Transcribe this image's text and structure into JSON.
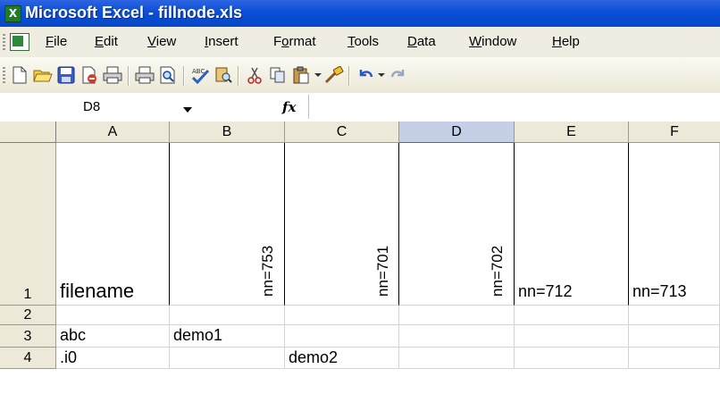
{
  "window": {
    "title": "Microsoft Excel - fillnode.xls"
  },
  "menu": [
    "File",
    "Edit",
    "View",
    "Insert",
    "Format",
    "Tools",
    "Data",
    "Window",
    "Help"
  ],
  "toolbar": {
    "buttons": [
      "new-icon",
      "open-icon",
      "save-icon",
      "permission-icon",
      "print-icon",
      "print-preview-icon",
      "spelling-icon",
      "research-icon",
      "cut-icon",
      "copy-icon",
      "paste-icon",
      "format-painter-icon",
      "undo-icon",
      "redo-icon"
    ]
  },
  "formula_bar": {
    "name_box": "D8",
    "fx": "fx",
    "formula": ""
  },
  "sheet": {
    "columns": [
      "A",
      "B",
      "C",
      "D",
      "E",
      "F"
    ],
    "active_column": "D",
    "rows": [
      {
        "num": "1",
        "cells": {
          "A": "filename",
          "B": "nn=753",
          "C": "nn=701",
          "D": "nn=702",
          "E": "nn=712",
          "F": "nn=713"
        }
      },
      {
        "num": "2",
        "cells": {
          "A": "",
          "B": "",
          "C": "",
          "D": "",
          "E": "",
          "F": ""
        }
      },
      {
        "num": "3",
        "cells": {
          "A": "abc",
          "B": "demo1",
          "C": "",
          "D": "",
          "E": "",
          "F": ""
        }
      },
      {
        "num": "4",
        "cells": {
          "A": ".i0",
          "B": "",
          "C": "demo2",
          "D": "",
          "E": "",
          "F": ""
        }
      }
    ]
  },
  "colors": {
    "title_bar": "#0a4fd8",
    "menu_bg": "#efede2",
    "header_bg": "#ece9d8",
    "active_header": "#c5cfe6"
  }
}
